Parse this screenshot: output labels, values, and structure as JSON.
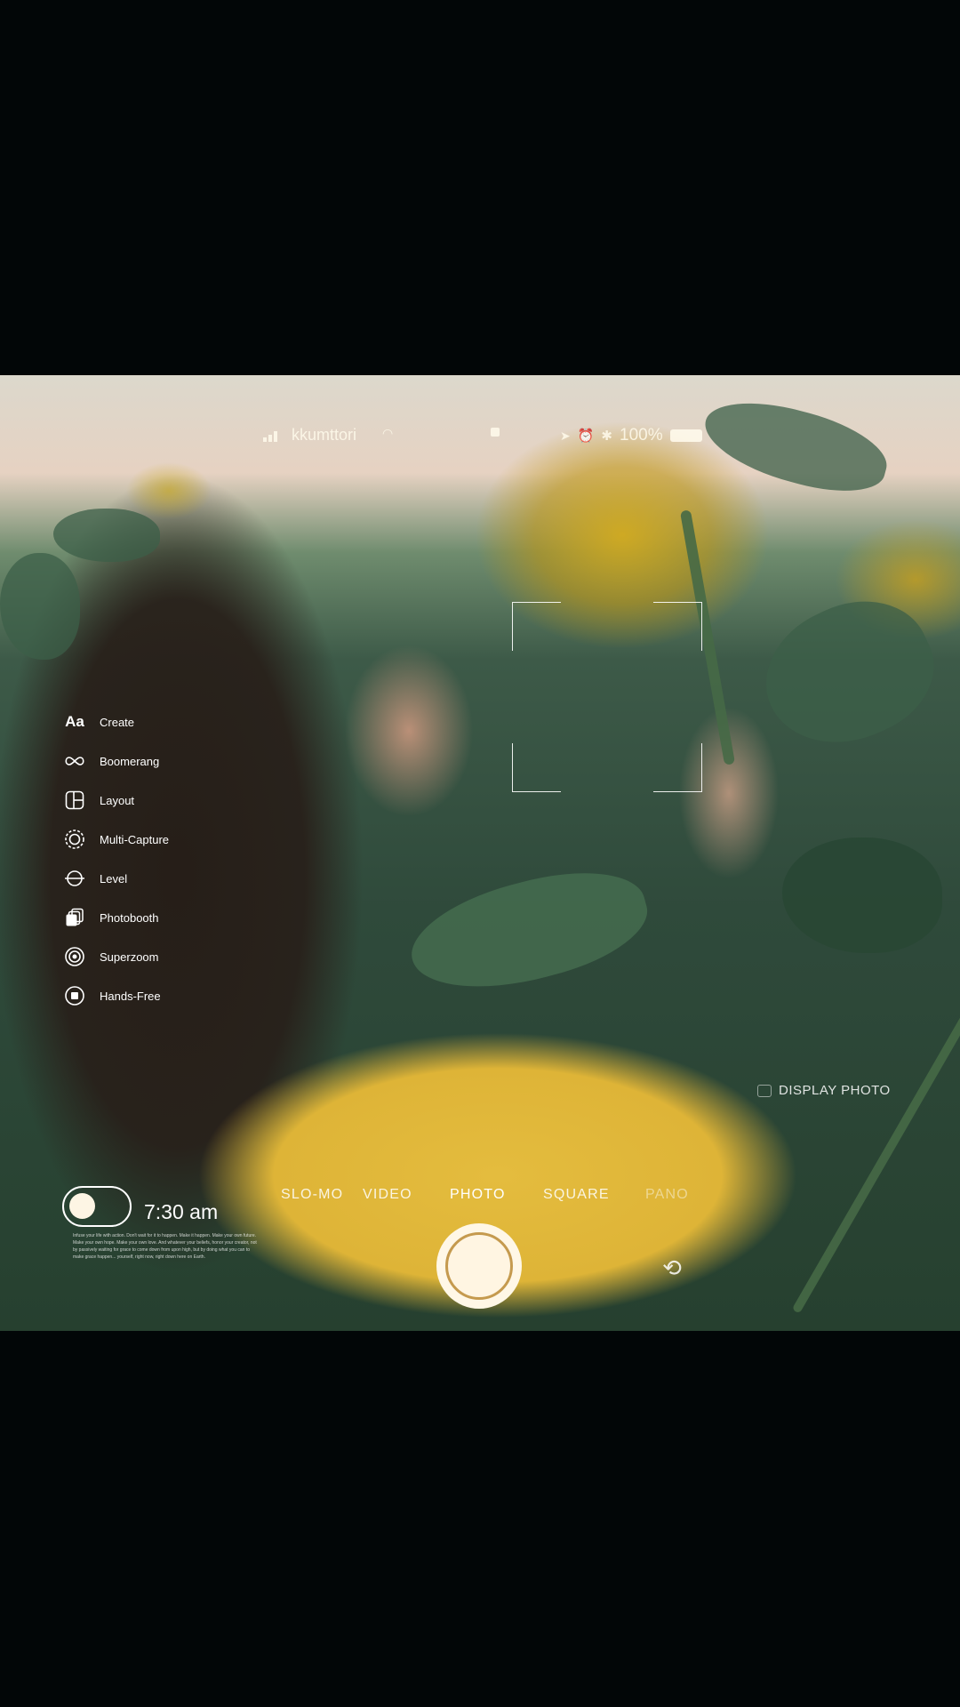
{
  "status_bar": {
    "carrier": "kkumttori",
    "battery_percent": "100%",
    "icons": [
      "signal-icon",
      "wifi-icon",
      "lock-icon",
      "location-icon",
      "alarm-icon",
      "bluetooth-icon",
      "battery-icon"
    ]
  },
  "modes_menu": [
    {
      "icon": "text-aa-icon",
      "label": "Create"
    },
    {
      "icon": "infinity-icon",
      "label": "Boomerang"
    },
    {
      "icon": "layout-icon",
      "label": "Layout"
    },
    {
      "icon": "multi-capture-icon",
      "label": "Multi-Capture"
    },
    {
      "icon": "level-icon",
      "label": "Level"
    },
    {
      "icon": "photobooth-icon",
      "label": "Photobooth"
    },
    {
      "icon": "superzoom-icon",
      "label": "Superzoom"
    },
    {
      "icon": "hands-free-icon",
      "label": "Hands-Free"
    }
  ],
  "display_photo": {
    "label": "DISPLAY PHOTO"
  },
  "clock": {
    "time": "7:30 am"
  },
  "fineprint": "Infuse your life with action. Don't wait for it to happen. Make it happen. Make your own future. Make your own hope. Make your own love. And whatever your beliefs, honor your creator, not by passively waiting for grace to come down from upon high, but by doing what you can to make grace happen... yourself, right now, right down here on Earth.",
  "capture_modes": [
    {
      "label": "SLO-MO",
      "state": "partial"
    },
    {
      "label": "VIDEO",
      "state": "normal"
    },
    {
      "label": "PHOTO",
      "state": "active"
    },
    {
      "label": "SQUARE",
      "state": "normal"
    },
    {
      "label": "PANO",
      "state": "faded"
    }
  ],
  "controls": {
    "shutter": "shutter-button",
    "flip": "camera-flip-icon",
    "toggle_state": "off"
  },
  "colors": {
    "background": "#020607",
    "shutter_fill": "#fff7e6",
    "shutter_ring": "#c59a4e",
    "text": "#ffffff"
  }
}
